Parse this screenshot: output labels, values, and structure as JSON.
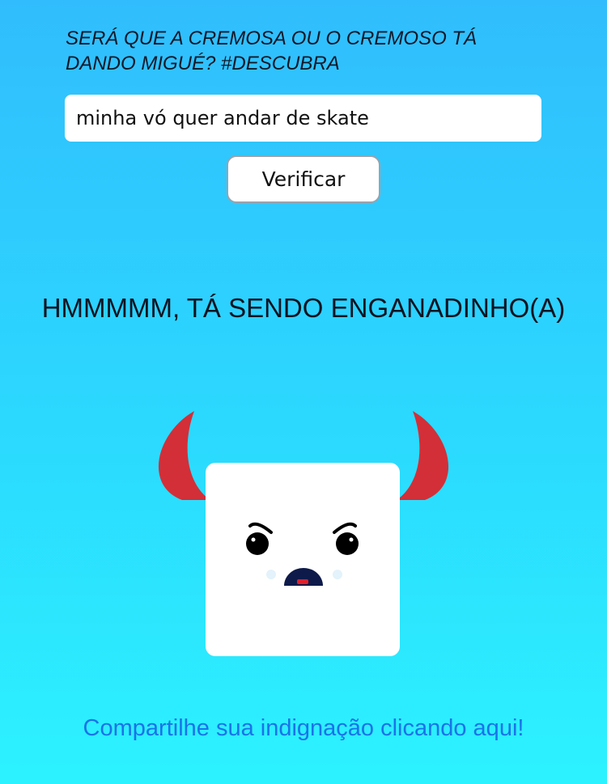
{
  "header": {
    "line1": "SERÁ QUE A CREMOSA OU O CREMOSO TÁ",
    "line2": "DANDO MIGUÉ? #DESCUBRA"
  },
  "form": {
    "input_value": "minha vó quer andar de skate",
    "button_label": "Verificar"
  },
  "result": {
    "text": "HMMMMM, TÁ SENDO ENGANADINHO(A)"
  },
  "mascot": {
    "icon": "angry-devil-marshmallow-icon",
    "horn_color": "#d32f38",
    "body_color": "#ffffff",
    "mouth_color": "#0d1a4a",
    "tongue_color": "#e0202a"
  },
  "footer": {
    "share_text": "Compartilhe sua indignação clicando aqui!"
  },
  "colors": {
    "background_top": "#31bdfd",
    "background_bottom": "#2cf2ff",
    "link": "#1a73e8"
  }
}
